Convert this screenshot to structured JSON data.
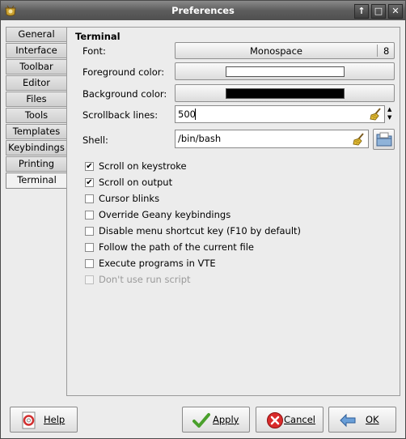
{
  "window": {
    "title": "Preferences"
  },
  "tabs": [
    {
      "label": "General"
    },
    {
      "label": "Interface"
    },
    {
      "label": "Toolbar"
    },
    {
      "label": "Editor"
    },
    {
      "label": "Files"
    },
    {
      "label": "Tools"
    },
    {
      "label": "Templates"
    },
    {
      "label": "Keybindings"
    },
    {
      "label": "Printing"
    },
    {
      "label": "Terminal"
    }
  ],
  "terminal": {
    "section_title": "Terminal",
    "font_label": "Font:",
    "font_name": "Monospace",
    "font_size": "8",
    "fg_label": "Foreground color:",
    "fg_color": "#ffffff",
    "bg_label": "Background color:",
    "bg_color": "#000000",
    "scrollback_label": "Scrollback lines:",
    "scrollback_value": "500",
    "shell_label": "Shell:",
    "shell_value": "/bin/bash",
    "options": [
      {
        "label": "Scroll on keystroke",
        "checked": true
      },
      {
        "label": "Scroll on output",
        "checked": true
      },
      {
        "label": "Cursor blinks",
        "checked": false
      },
      {
        "label": "Override Geany keybindings",
        "checked": false
      },
      {
        "label": "Disable menu shortcut key (F10 by default)",
        "checked": false
      },
      {
        "label": "Follow the path of the current file",
        "checked": false
      },
      {
        "label": "Execute programs in VTE",
        "checked": false
      },
      {
        "label": "Don't use run script",
        "checked": false,
        "disabled": true
      }
    ]
  },
  "buttons": {
    "help": "Help",
    "apply": "Apply",
    "cancel": "Cancel",
    "ok": "OK"
  }
}
